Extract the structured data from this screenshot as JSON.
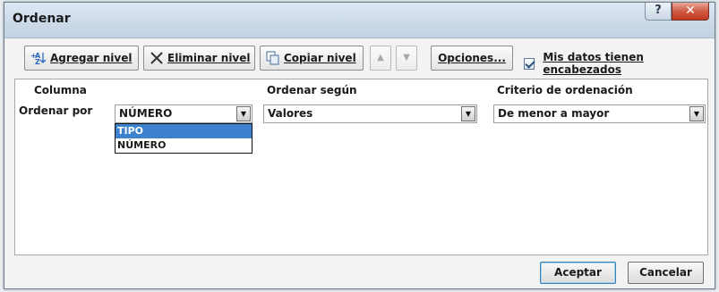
{
  "window": {
    "title": "Ordenar",
    "help_label": "?",
    "close_label": "✕"
  },
  "toolbar": {
    "add_level": "Agregar nivel",
    "delete_level": "Eliminar nivel",
    "copy_level": "Copiar nivel",
    "move_up": "▲",
    "move_down": "▼",
    "options": "Opciones...",
    "headers_checkbox_label": "Mis datos tienen encabezados",
    "headers_checked": true
  },
  "grid": {
    "headers": {
      "column": "Columna",
      "sort_on": "Ordenar según",
      "order": "Criterio de ordenación"
    },
    "row": {
      "label": "Ordenar por",
      "column_value": "NÚMERO",
      "sort_on_value": "Valores",
      "order_value": "De menor a mayor"
    },
    "dropdown_options": [
      "TIPO",
      "NÚMERO"
    ],
    "dropdown_highlighted": "TIPO"
  },
  "footer": {
    "ok": "Aceptar",
    "cancel": "Cancelar"
  },
  "colors": {
    "title_bar": "#cbd9e8",
    "close_button": "#c23a22",
    "selection": "#3c82cd"
  }
}
